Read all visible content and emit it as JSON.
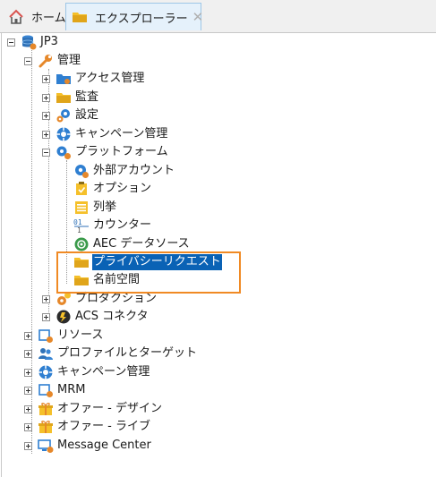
{
  "tabs": {
    "home_label": "ホーム",
    "explorer_label": "エクスプローラー",
    "close_glyph": "✕"
  },
  "tree": {
    "root": {
      "label": "JP3"
    },
    "admin": {
      "label": "管理"
    },
    "access": {
      "label": "アクセス管理"
    },
    "audit": {
      "label": "監査"
    },
    "settings": {
      "label": "設定"
    },
    "campaign_admin": {
      "label": "キャンペーン管理"
    },
    "platform": {
      "label": "プラットフォーム"
    },
    "external_accounts": {
      "label": "外部アカウント"
    },
    "options": {
      "label": "オプション"
    },
    "enumerations": {
      "label": "列挙"
    },
    "counters": {
      "label": "カウンター"
    },
    "aec_datasource": {
      "label": "AEC データソース"
    },
    "privacy_requests": {
      "label": "プライバシーリクエスト"
    },
    "namespaces": {
      "label": "名前空間"
    },
    "production": {
      "label": "プロダクション"
    },
    "acs_connector": {
      "label": "ACS コネクタ"
    },
    "resources": {
      "label": "リソース"
    },
    "profiles_targets": {
      "label": "プロファイルとターゲット"
    },
    "campaign_mgmt": {
      "label": "キャンペーン管理"
    },
    "mrm": {
      "label": "MRM"
    },
    "offer_design": {
      "label": "オファー - デザイン"
    },
    "offer_live": {
      "label": "オファー - ライブ"
    },
    "message_center": {
      "label": "Message Center"
    }
  },
  "colors": {
    "selection": "#0a62b5",
    "highlight_box": "#f08a24",
    "folder": "#f5c02a",
    "gear_blue": "#2f7fd1",
    "wrench_orange": "#e6882a"
  }
}
